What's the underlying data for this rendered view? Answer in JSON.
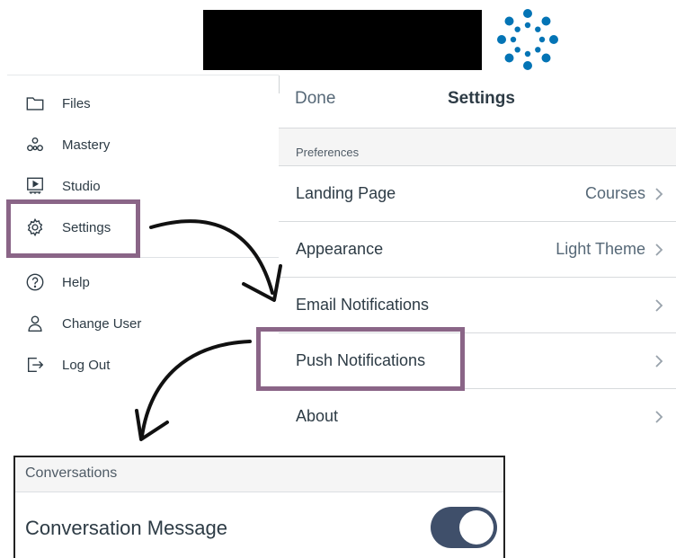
{
  "left_menu": {
    "items": [
      {
        "label": "Files",
        "icon": "folder-icon"
      },
      {
        "label": "Mastery",
        "icon": "mastery-icon"
      },
      {
        "label": "Studio",
        "icon": "studio-icon"
      },
      {
        "label": "Settings",
        "icon": "gear-icon"
      },
      {
        "label": "Help",
        "icon": "help-icon"
      },
      {
        "label": "Change User",
        "icon": "user-icon"
      },
      {
        "label": "Log Out",
        "icon": "logout-icon"
      }
    ]
  },
  "settings": {
    "done_label": "Done",
    "title": "Settings",
    "section_label": "Preferences",
    "rows": [
      {
        "label": "Landing Page",
        "value": "Courses"
      },
      {
        "label": "Appearance",
        "value": "Light Theme"
      },
      {
        "label": "Email Notifications",
        "value": ""
      },
      {
        "label": "Push Notifications",
        "value": ""
      },
      {
        "label": "About",
        "value": ""
      }
    ]
  },
  "conversations": {
    "section_label": "Conversations",
    "message_label": "Conversation Message",
    "toggle_on": true
  },
  "colors": {
    "highlight": "#8a6587",
    "brand": "#0374b5",
    "toggle": "#3f4f6a",
    "text": "#2d3b45"
  }
}
